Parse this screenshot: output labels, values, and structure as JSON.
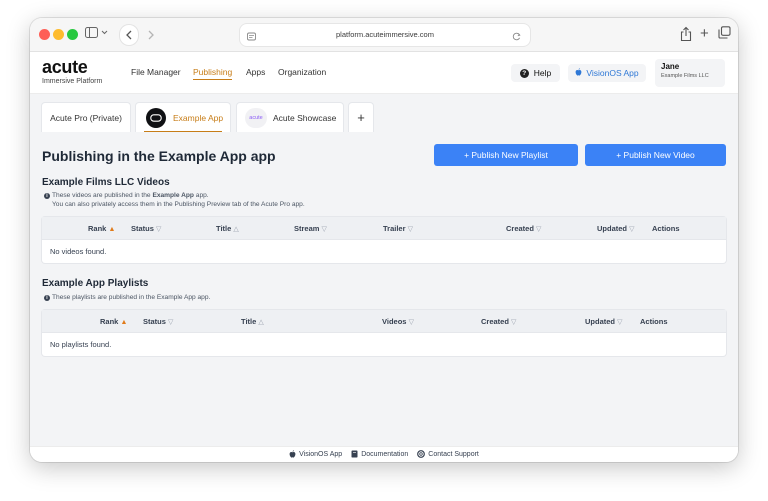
{
  "browser": {
    "url": "platform.acuteimmersive.com"
  },
  "header": {
    "logo": "acute",
    "logo_subtitle": "Immersive Platform",
    "nav": [
      {
        "label": "File Manager"
      },
      {
        "label": "Publishing",
        "active": true
      },
      {
        "label": "Apps"
      },
      {
        "label": "Organization"
      }
    ],
    "help_label": "Help",
    "visionos_label": "VisionOS App",
    "user": {
      "name": "Jane",
      "org": "Example Films LLC"
    }
  },
  "app_tabs": [
    {
      "label": "Acute Pro (Private)"
    },
    {
      "label": "Example App",
      "active": true
    },
    {
      "label": "Acute Showcase",
      "logo_text": "acute"
    },
    {
      "label": "+"
    }
  ],
  "page": {
    "title": "Publishing in the Example App app",
    "publish_playlist": "+ Publish New Playlist",
    "publish_video": "+ Publish New Video"
  },
  "videos_section": {
    "title": "Example Films LLC Videos",
    "note_pre": "These videos are published in the ",
    "note_bold": "Example App",
    "note_post": " app.",
    "note_line2": "You can also privately access them in the Publishing Preview tab of the Acute Pro app.",
    "columns": [
      {
        "label": "Rank",
        "sort": "▲"
      },
      {
        "label": "Status",
        "sort": "▽"
      },
      {
        "label": "Title",
        "sort": "△"
      },
      {
        "label": "Stream",
        "sort": "▽"
      },
      {
        "label": "Trailer",
        "sort": "▽"
      },
      {
        "label": "Created",
        "sort": "▽"
      },
      {
        "label": "Updated",
        "sort": "▽"
      },
      {
        "label": "Actions",
        "sort": ""
      }
    ],
    "empty": "No videos found."
  },
  "playlists_section": {
    "title": "Example App Playlists",
    "note": "These playlists are published in the Example App app.",
    "columns": [
      {
        "label": "Rank",
        "sort": "▲"
      },
      {
        "label": "Status",
        "sort": "▽"
      },
      {
        "label": "Title",
        "sort": "△"
      },
      {
        "label": "Videos",
        "sort": "▽"
      },
      {
        "label": "Created",
        "sort": "▽"
      },
      {
        "label": "Updated",
        "sort": "▽"
      },
      {
        "label": "Actions",
        "sort": ""
      }
    ],
    "empty": "No playlists found."
  },
  "footer": {
    "visionos": "VisionOS App",
    "docs": "Documentation",
    "support": "Contact Support"
  },
  "colors": {
    "accent": "#c77d18",
    "primary": "#3b82f6",
    "link_blue": "#2f78d6"
  }
}
